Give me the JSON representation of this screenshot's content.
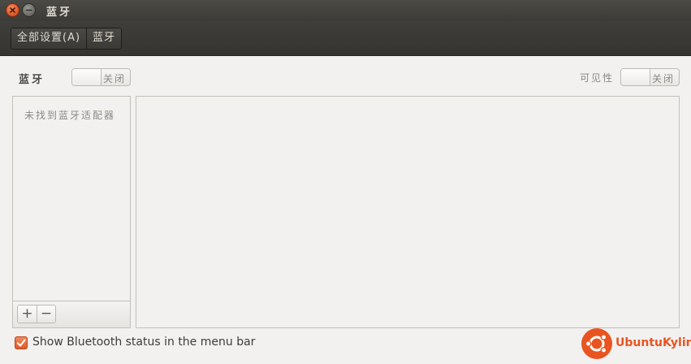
{
  "window": {
    "title": "蓝牙"
  },
  "toolbar": {
    "crumbs": [
      "全部设置(A)",
      "蓝牙"
    ]
  },
  "bluetooth": {
    "label": "蓝牙",
    "switch_state": "关闭"
  },
  "visibility": {
    "label": "可见性",
    "switch_state": "关闭"
  },
  "device_list": {
    "empty_message": "未找到蓝牙适配器",
    "add_label": "+",
    "remove_label": "−"
  },
  "menu_bar_option": {
    "label": "Show Bluetooth status in the menu bar",
    "checked": true
  },
  "brand": {
    "name": "UbuntuKylin"
  },
  "colors": {
    "accent": "#e95420",
    "titlebar": "#3c3b37",
    "window_bg": "#f2f1f0"
  },
  "icons": [
    "close-icon",
    "minimize-icon",
    "checkmark-icon",
    "ubuntu-logo-icon"
  ]
}
